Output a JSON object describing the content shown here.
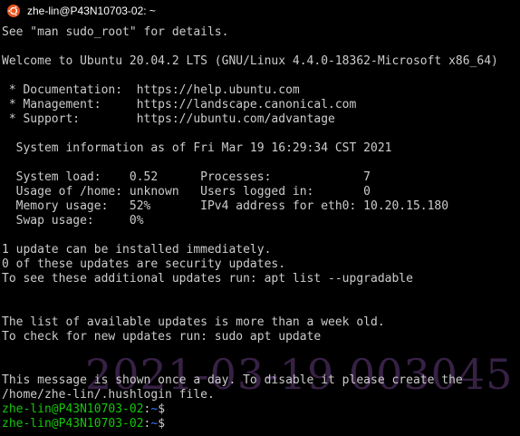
{
  "window": {
    "title": "zhe-lin@P43N10703-02: ~",
    "icon": "ubuntu-icon"
  },
  "terminal": {
    "lines": [
      "See \"man sudo_root\" for details.",
      "",
      "Welcome to Ubuntu 20.04.2 LTS (GNU/Linux 4.4.0-18362-Microsoft x86_64)",
      "",
      " * Documentation:  https://help.ubuntu.com",
      " * Management:     https://landscape.canonical.com",
      " * Support:        https://ubuntu.com/advantage",
      "",
      "  System information as of Fri Mar 19 16:29:34 CST 2021",
      "",
      "  System load:    0.52      Processes:             7",
      "  Usage of /home: unknown   Users logged in:       0",
      "  Memory usage:   52%       IPv4 address for eth0: 10.20.15.180",
      "  Swap usage:     0%",
      "",
      "1 update can be installed immediately.",
      "0 of these updates are security updates.",
      "To see these additional updates run: apt list --upgradable",
      "",
      "",
      "The list of available updates is more than a week old.",
      "To check for new updates run: sudo apt update",
      "",
      "",
      "This message is shown once a day. To disable it please create the",
      "/home/zhe-lin/.hushlogin file."
    ],
    "prompts": [
      {
        "user_host": "zhe-lin@P43N10703-02",
        "separator": ":",
        "path": "~",
        "symbol": "$"
      },
      {
        "user_host": "zhe-lin@P43N10703-02",
        "separator": ":",
        "path": "~",
        "symbol": "$"
      }
    ]
  },
  "watermark": {
    "text": "2021-03-19 003045"
  },
  "colors": {
    "background": "#000000",
    "text": "#cccccc",
    "prompt_user": "#16c60c",
    "prompt_path": "#3b78ff",
    "watermark": "#4a2d5c",
    "ubuntu_orange": "#e95420"
  }
}
